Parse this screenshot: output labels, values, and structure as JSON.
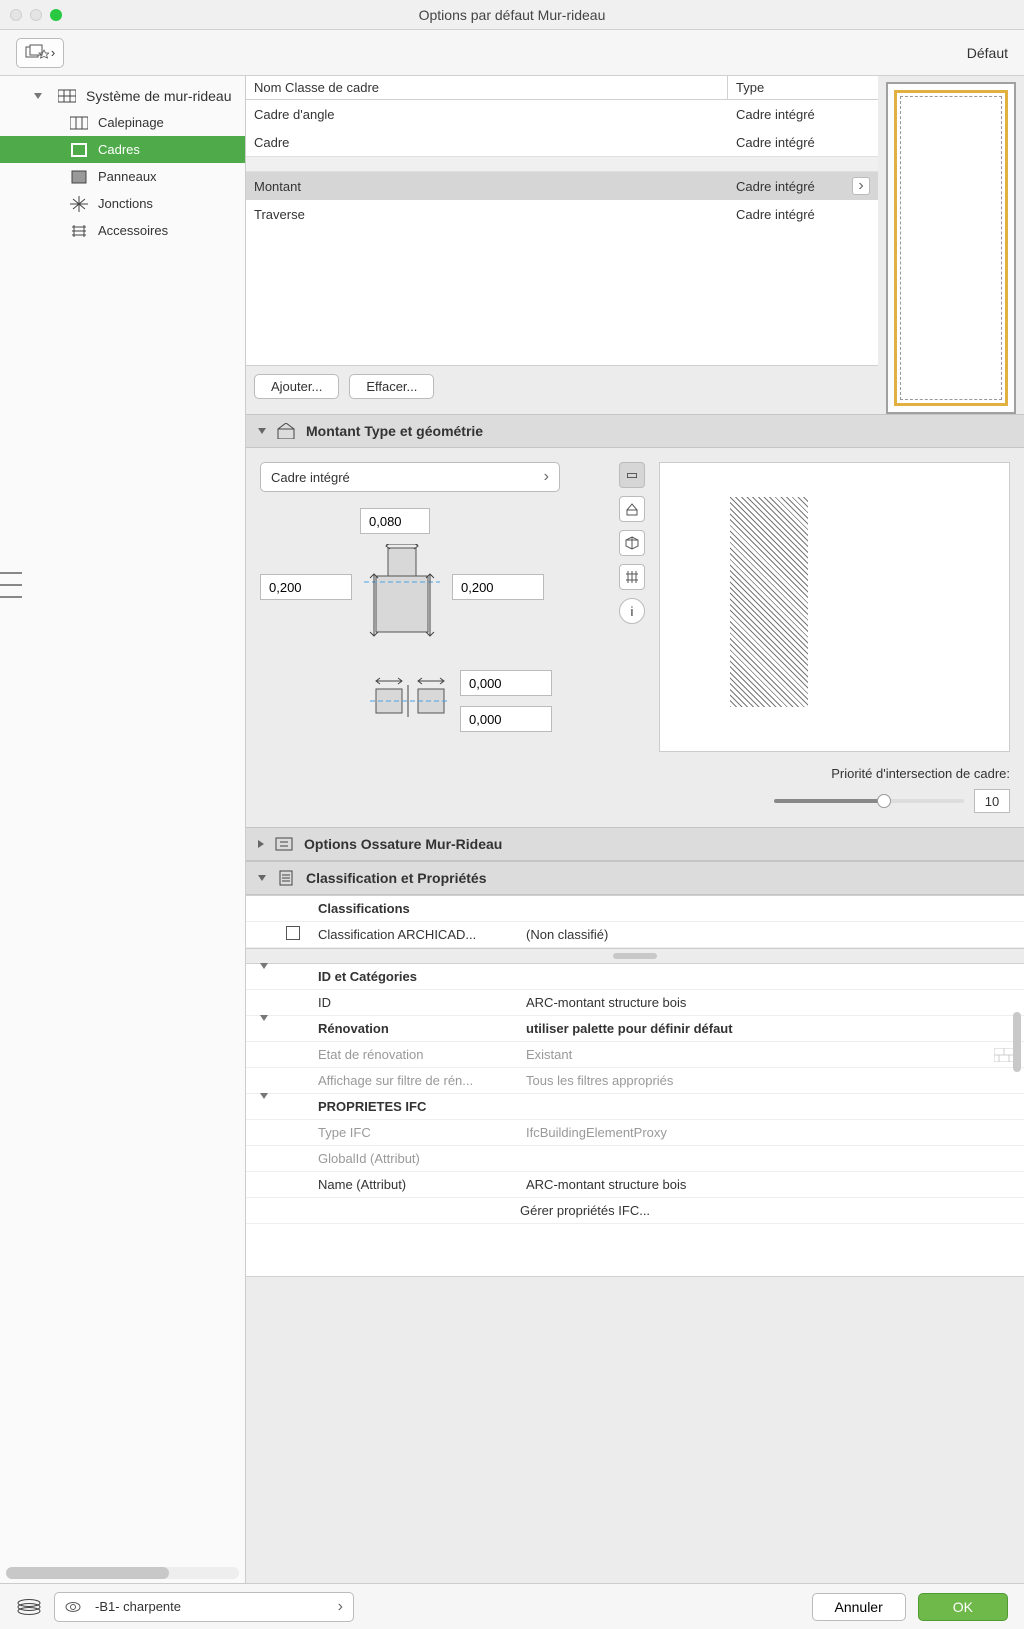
{
  "window": {
    "title": "Options par défaut Mur-rideau"
  },
  "toolbar": {
    "default_label": "Défaut"
  },
  "sidebar": {
    "root": "Système de mur-rideau",
    "items": [
      "Calepinage",
      "Cadres",
      "Panneaux",
      "Jonctions",
      "Accessoires"
    ],
    "selected_index": 1
  },
  "frame_list": {
    "header_col1": "Nom Classe de cadre",
    "header_col2": "Type",
    "rows_a": [
      {
        "name": "Cadre d'angle",
        "type": "Cadre intégré"
      },
      {
        "name": "Cadre",
        "type": "Cadre intégré"
      }
    ],
    "rows_b": [
      {
        "name": "Montant",
        "type": "Cadre intégré",
        "selected": true
      },
      {
        "name": "Traverse",
        "type": "Cadre intégré"
      }
    ],
    "add_btn": "Ajouter...",
    "remove_btn": "Effacer..."
  },
  "geometry": {
    "section_title": "Montant Type et géométrie",
    "type_combo": "Cadre intégré",
    "dim_top": "0,080",
    "dim_left": "0,200",
    "dim_right": "0,200",
    "dim_offset1": "0,000",
    "dim_offset2": "0,000",
    "priority_label": "Priorité d'intersection de cadre:",
    "priority_value": "10"
  },
  "sections": {
    "frame_options": "Options Ossature Mur-Rideau",
    "classification": "Classification et Propriétés"
  },
  "props": {
    "classifications_head": "Classifications",
    "classification_row_label": "Classification ARCHICAD...",
    "classification_row_value": "(Non classifié)",
    "id_cat_head": "ID et Catégories",
    "id_label": "ID",
    "id_value": "ARC-montant structure bois",
    "renov_head": "Rénovation",
    "renov_head_val": "utiliser palette pour définir défaut",
    "renov_state_label": "Etat de rénovation",
    "renov_state_value": "Existant",
    "renov_filter_label": "Affichage sur filtre de rén...",
    "renov_filter_value": "Tous les filtres appropriés",
    "ifc_head": "PROPRIETES IFC",
    "ifc_type_label": "Type IFC",
    "ifc_type_value": "IfcBuildingElementProxy",
    "ifc_globalid_label": "GlobalId (Attribut)",
    "ifc_name_label": "Name (Attribut)",
    "ifc_name_value": "ARC-montant structure bois",
    "manage_ifc": "Gérer propriétés IFC..."
  },
  "footer": {
    "layer": "-B1- charpente",
    "cancel": "Annuler",
    "ok": "OK"
  }
}
